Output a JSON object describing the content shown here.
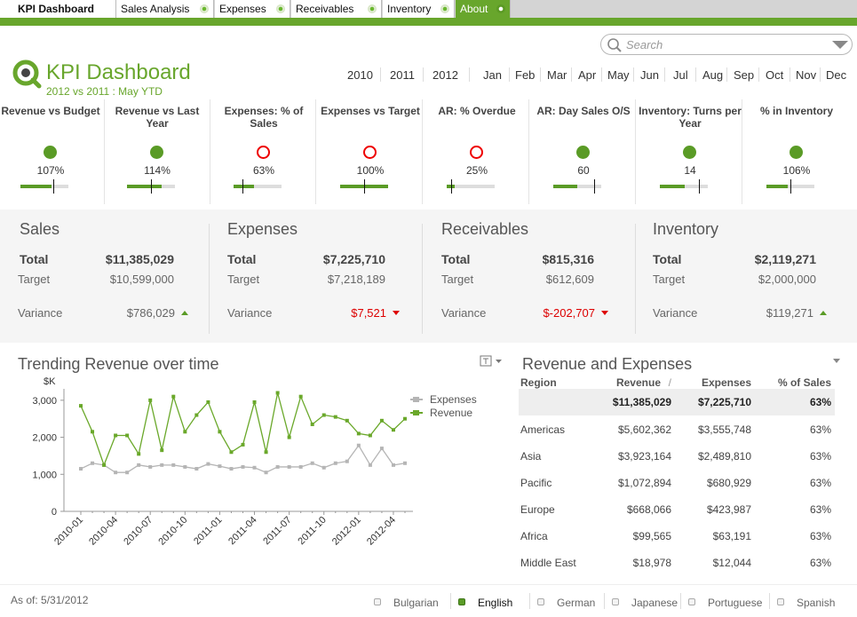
{
  "tabs": [
    {
      "label": "KPI Dashboard",
      "active": true
    },
    {
      "label": "Sales Analysis"
    },
    {
      "label": "Expenses"
    },
    {
      "label": "Receivables"
    },
    {
      "label": "Inventory"
    },
    {
      "label": "About"
    }
  ],
  "search": {
    "placeholder": "Search"
  },
  "header": {
    "title": "KPI Dashboard",
    "subtitle": "2012 vs 2011 : May YTD"
  },
  "years": [
    "2010",
    "2011",
    "2012"
  ],
  "months": [
    "Jan",
    "Feb",
    "Mar",
    "Apr",
    "May",
    "Jun",
    "Jul",
    "Aug",
    "Sep",
    "Oct",
    "Nov",
    "Dec"
  ],
  "kpis": [
    {
      "label": "Revenue vs Budget",
      "value": "107%",
      "status": "good",
      "fill": 0.65,
      "marker": 0.68
    },
    {
      "label": "Revenue vs Last Year",
      "value": "114%",
      "status": "good",
      "fill": 0.72,
      "marker": 0.5
    },
    {
      "label": "Expenses: % of Sales",
      "value": "63%",
      "status": "bad",
      "fill": 0.42,
      "marker": 0.18
    },
    {
      "label": "Expenses vs Target",
      "value": "100%",
      "status": "bad",
      "fill": 1.0,
      "marker": 0.5
    },
    {
      "label": "AR: % Overdue",
      "value": "25%",
      "status": "bad",
      "fill": 0.16,
      "marker": 0.1
    },
    {
      "label": "AR: Day Sales O/S",
      "value": "60",
      "status": "good",
      "fill": 0.5,
      "marker": 0.86
    },
    {
      "label": "Inventory: Turns per Year",
      "value": "14",
      "status": "good",
      "fill": 0.52,
      "marker": 0.82
    },
    {
      "label": "% in Inventory",
      "value": "106%",
      "status": "good",
      "fill": 0.45,
      "marker": 0.5
    }
  ],
  "summary": [
    {
      "title": "Sales",
      "total_label": "Total",
      "total": "$11,385,029",
      "target_label": "Target",
      "target": "$10,599,000",
      "variance_label": "Variance",
      "variance": "$786,029",
      "trend": "up"
    },
    {
      "title": "Expenses",
      "total_label": "Total",
      "total": "$7,225,710",
      "target_label": "Target",
      "target": "$7,218,189",
      "variance_label": "Variance",
      "variance": "$7,521",
      "trend": "down"
    },
    {
      "title": "Receivables",
      "total_label": "Total",
      "total": "$815,316",
      "target_label": "Target",
      "target": "$612,609",
      "variance_label": "Variance",
      "variance": "$-202,707",
      "trend": "down"
    },
    {
      "title": "Inventory",
      "total_label": "Total",
      "total": "$2,119,271",
      "target_label": "Target",
      "target": "$2,000,000",
      "variance_label": "Variance",
      "variance": "$119,271",
      "trend": "up"
    }
  ],
  "chart": {
    "title": "Trending Revenue over time"
  },
  "chart_data": {
    "type": "line",
    "title": "Trending Revenue over time",
    "ylabel": "$K",
    "ylim": [
      0,
      3500
    ],
    "yticks": [
      "0",
      "1,000",
      "2,000",
      "3,000"
    ],
    "x": [
      "2010-01",
      "2010-02",
      "2010-03",
      "2010-04",
      "2010-05",
      "2010-06",
      "2010-07",
      "2010-08",
      "2010-09",
      "2010-10",
      "2010-11",
      "2010-12",
      "2011-01",
      "2011-02",
      "2011-03",
      "2011-04",
      "2011-05",
      "2011-06",
      "2011-07",
      "2011-08",
      "2011-09",
      "2011-10",
      "2011-11",
      "2011-12",
      "2012-01",
      "2012-02",
      "2012-03",
      "2012-04",
      "2012-05"
    ],
    "xticklabels": [
      "2010-01",
      "2010-04",
      "2010-07",
      "2010-10",
      "2011-01",
      "2011-04",
      "2011-07",
      "2011-10",
      "2012-01",
      "2012-04"
    ],
    "legend": "top-right",
    "series": [
      {
        "name": "Expenses",
        "color": "#b5b5b5",
        "values": [
          1150,
          1300,
          1250,
          1050,
          1050,
          1250,
          1200,
          1250,
          1250,
          1200,
          1150,
          1280,
          1220,
          1150,
          1200,
          1180,
          1050,
          1200,
          1200,
          1200,
          1300,
          1180,
          1300,
          1350,
          1780,
          1250,
          1700,
          1250,
          1300
        ]
      },
      {
        "name": "Revenue",
        "color": "#6aa82a",
        "values": [
          2850,
          2150,
          1250,
          2050,
          2050,
          1550,
          3000,
          1650,
          3100,
          2150,
          2600,
          2950,
          2150,
          1600,
          1800,
          2950,
          1600,
          3200,
          2000,
          3100,
          2350,
          2600,
          2550,
          2450,
          2100,
          2050,
          2450,
          2200,
          2500
        ]
      }
    ]
  },
  "table": {
    "title": "Revenue and Expenses",
    "headers": [
      "Region",
      "Revenue",
      "Expenses",
      "% of Sales"
    ],
    "sort_mark": "/",
    "total": [
      "",
      "$11,385,029",
      "$7,225,710",
      "63%"
    ],
    "rows": [
      [
        "Americas",
        "$5,602,362",
        "$3,555,748",
        "63%"
      ],
      [
        "Asia",
        "$3,923,164",
        "$2,489,810",
        "63%"
      ],
      [
        "Pacific",
        "$1,072,894",
        "$680,929",
        "63%"
      ],
      [
        "Europe",
        "$668,066",
        "$423,987",
        "63%"
      ],
      [
        "Africa",
        "$99,565",
        "$63,191",
        "63%"
      ],
      [
        "Middle East",
        "$18,978",
        "$12,044",
        "63%"
      ]
    ]
  },
  "footer": {
    "asof": "As of: 5/31/2012",
    "languages": [
      "Bulgarian",
      "English",
      "German",
      "Japanese",
      "Portuguese",
      "Spanish"
    ],
    "selected_language": "English"
  },
  "colors": {
    "brand": "#68a62c",
    "good": "#5a9b26",
    "bad": "#dd0000"
  }
}
